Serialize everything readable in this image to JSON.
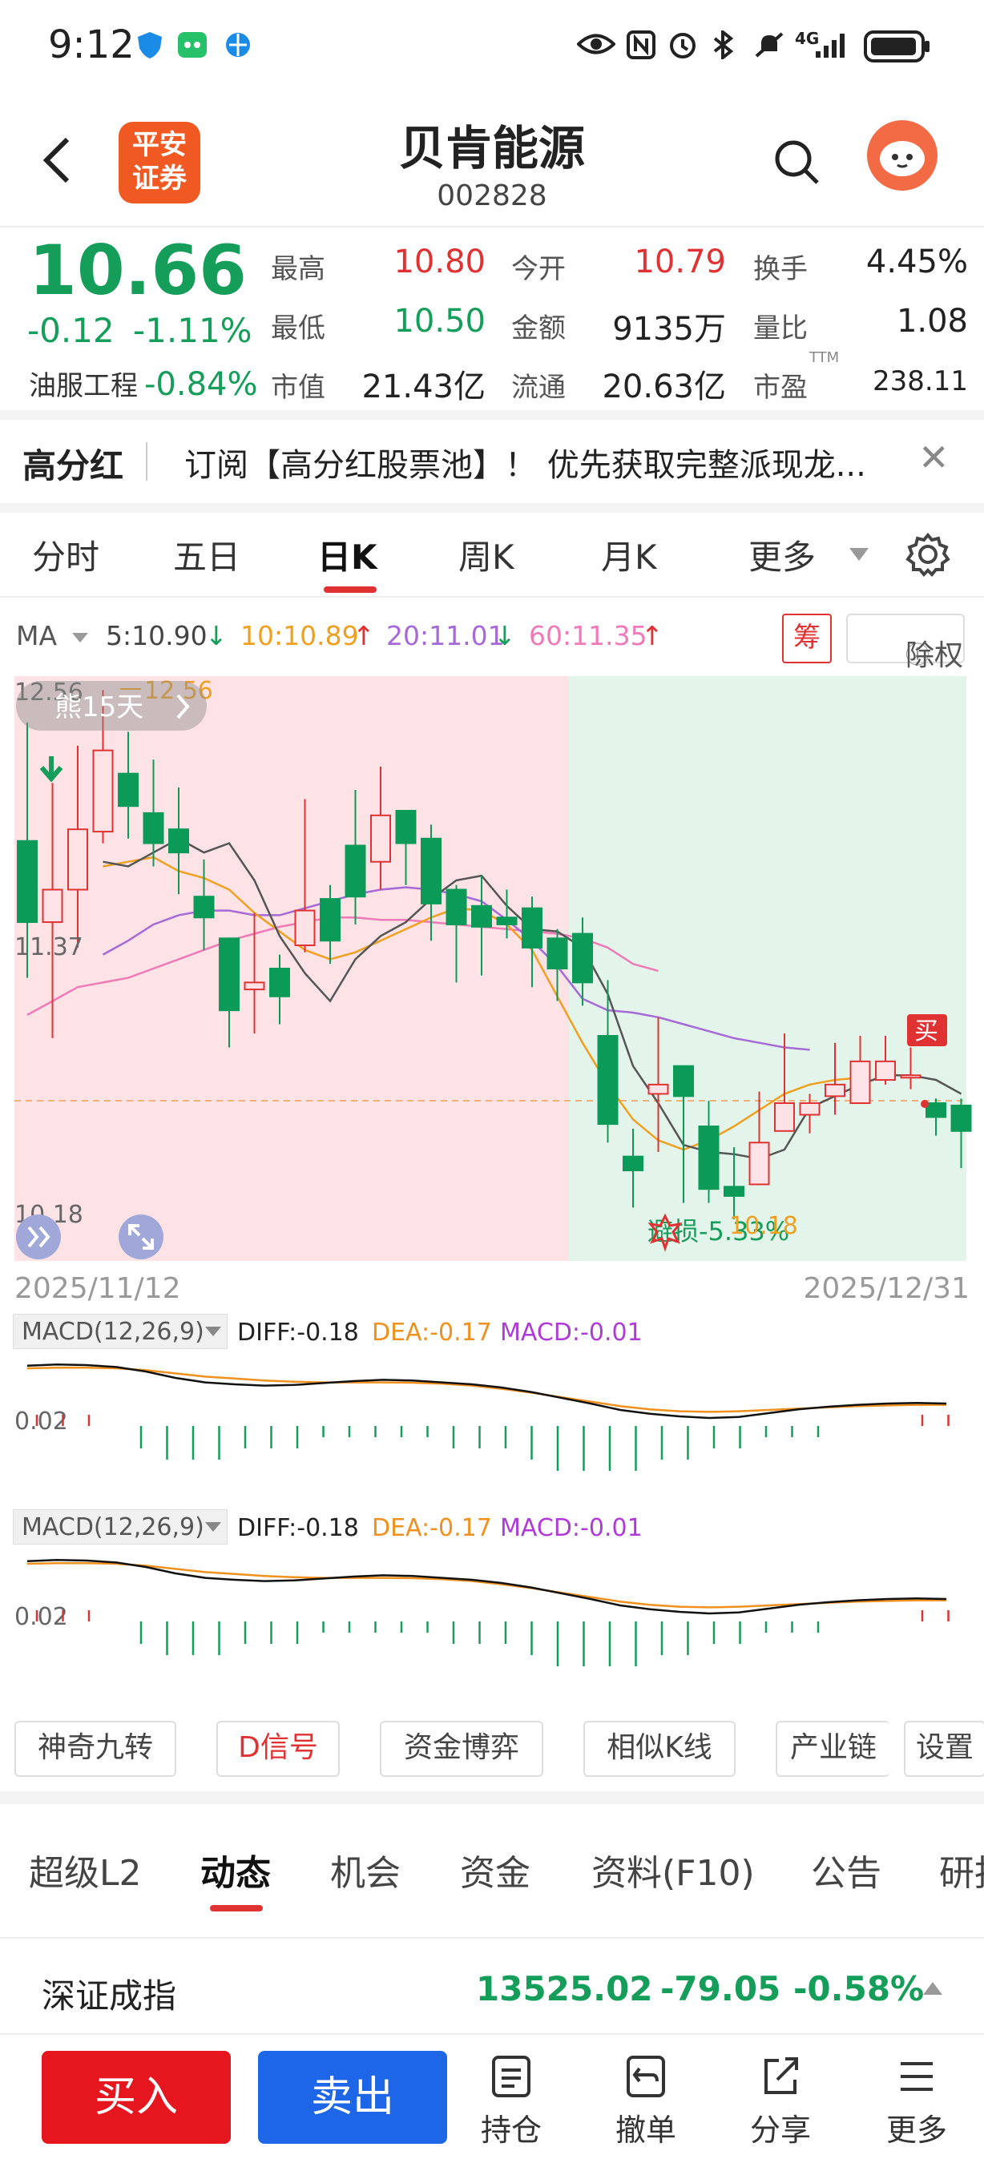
{
  "status_bar": {
    "time": "9:12",
    "net": "4G"
  },
  "header": {
    "stock_name": "贝肯能源",
    "stock_code": "002828",
    "broker_logo_line1": "平安",
    "broker_logo_line2": "证券"
  },
  "quote": {
    "price": "10.66",
    "change": "-0.12",
    "change_pct": "-1.11%",
    "sector_name": "油服工程",
    "sector_pct": "-0.84%",
    "fields": [
      {
        "label": "最高",
        "value": "10.80",
        "color": "#e03232"
      },
      {
        "label": "今开",
        "value": "10.79",
        "color": "#e03232"
      },
      {
        "label": "换手",
        "value": "4.45%",
        "color": "#222222"
      },
      {
        "label": "最低",
        "value": "10.50",
        "color": "#159d5a"
      },
      {
        "label": "金额",
        "value": "9135万",
        "color": "#222222"
      },
      {
        "label": "量比",
        "value": "1.08",
        "color": "#222222"
      },
      {
        "label": "市值",
        "value": "21.43亿",
        "color": "#222222"
      },
      {
        "label": "流通",
        "value": "20.63亿",
        "color": "#222222"
      },
      {
        "label": "市盈",
        "value": "238.11",
        "color": "#222222",
        "sup": "TTM"
      }
    ]
  },
  "banner": {
    "tag": "高分红",
    "text": "订阅【高分红股票池】！ 优先获取完整派现龙...",
    "close": "✕"
  },
  "period_tabs": [
    {
      "label": "分时"
    },
    {
      "label": "五日"
    },
    {
      "label": "日K",
      "active": true
    },
    {
      "label": "周K"
    },
    {
      "label": "月K"
    },
    {
      "label": "更多"
    }
  ],
  "ma": {
    "label": "MA",
    "ma5": "5:10.90",
    "ma10": "10:10.89",
    "ma20": "20:11.01",
    "ma60": "60:11.35",
    "chou": "筹",
    "chuquan": "除权"
  },
  "kline": {
    "price_high": "12.56",
    "price_mid": "11.37",
    "price_low": "10.18",
    "high_mark": "12.56",
    "bear_badge": "熊15天",
    "low_mark": "10.18",
    "stop_loss": "避损-5.33%",
    "buy_tag": "买",
    "date_start": "2025/11/12",
    "date_end": "2025/12/31"
  },
  "macd_panels": [
    {
      "name": "MACD(12,26,9)",
      "diff": "DIFF:-0.18",
      "dea": "DEA:-0.17",
      "macd": "MACD:-0.01",
      "axis": "0.02"
    },
    {
      "name": "MACD(12,26,9)",
      "diff": "DIFF:-0.18",
      "dea": "DEA:-0.17",
      "macd": "MACD:-0.01",
      "axis": "0.02"
    }
  ],
  "tools": [
    "神奇九转",
    "D信号",
    "资金博弈",
    "相似K线",
    "产业链",
    "设置"
  ],
  "bottom_tabs": [
    {
      "label": "超级L2"
    },
    {
      "label": "动态",
      "active": true
    },
    {
      "label": "机会"
    },
    {
      "label": "资金"
    },
    {
      "label": "资料(F10)"
    },
    {
      "label": "公告"
    },
    {
      "label": "研报"
    }
  ],
  "index_bar": {
    "name": "深证成指",
    "value": "13525.02",
    "change": "-79.05",
    "pct": "-0.58%"
  },
  "actions": {
    "buy": "买入",
    "sell": "卖出",
    "items": [
      "持仓",
      "撤单",
      "分享",
      "更多"
    ]
  },
  "chart_data": {
    "type": "candlestick",
    "price_axis_labels": [
      12.56,
      11.37,
      10.18
    ],
    "date_range": [
      "2025/11/12",
      "2025/12/31"
    ],
    "candles": [
      [
        11.91,
        11.56,
        12.42,
        11.32
      ],
      [
        11.56,
        11.7,
        12.16,
        11.06
      ],
      [
        11.7,
        11.96,
        12.32,
        11.45
      ],
      [
        11.95,
        12.3,
        12.56,
        11.9
      ],
      [
        12.2,
        12.06,
        12.38,
        11.92
      ],
      [
        12.03,
        11.9,
        12.26,
        11.8
      ],
      [
        11.96,
        11.86,
        12.14,
        11.68
      ],
      [
        11.67,
        11.58,
        11.83,
        11.44
      ],
      [
        11.49,
        11.18,
        11.48,
        11.02
      ],
      [
        11.27,
        11.3,
        11.6,
        11.08
      ],
      [
        11.36,
        11.24,
        11.42,
        11.12
      ],
      [
        11.46,
        11.61,
        12.09,
        11.43
      ],
      [
        11.66,
        11.48,
        11.72,
        11.38
      ],
      [
        11.89,
        11.67,
        12.13,
        11.55
      ],
      [
        11.82,
        12.02,
        12.23,
        11.7
      ],
      [
        12.04,
        11.9,
        12.03,
        11.72
      ],
      [
        11.92,
        11.64,
        11.98,
        11.48
      ],
      [
        11.7,
        11.55,
        11.72,
        11.3
      ],
      [
        11.63,
        11.54,
        11.76,
        11.33
      ],
      [
        11.58,
        11.55,
        11.7,
        11.49
      ],
      [
        11.62,
        11.45,
        11.67,
        11.28
      ],
      [
        11.49,
        11.36,
        11.53,
        11.22
      ],
      [
        11.51,
        11.3,
        11.58,
        11.2
      ],
      [
        11.07,
        10.69,
        11.31,
        10.61
      ],
      [
        10.55,
        10.49,
        10.67,
        10.33
      ],
      [
        10.82,
        10.86,
        11.15,
        10.57
      ],
      [
        10.94,
        10.81,
        10.89,
        10.35
      ],
      [
        10.68,
        10.41,
        10.79,
        10.35
      ],
      [
        10.42,
        10.38,
        10.59,
        10.28
      ],
      [
        10.43,
        10.61,
        10.83,
        10.47
      ],
      [
        10.66,
        10.78,
        11.08,
        10.73
      ],
      [
        10.73,
        10.78,
        10.82,
        10.65
      ],
      [
        10.81,
        10.86,
        11.04,
        10.73
      ],
      [
        10.78,
        10.96,
        11.07,
        10.8
      ],
      [
        10.88,
        10.96,
        11.07,
        10.86
      ],
      [
        10.89,
        10.9,
        11.02,
        10.84
      ],
      [
        10.78,
        10.72,
        10.8,
        10.64
      ],
      [
        10.77,
        10.66,
        10.8,
        10.5
      ]
    ],
    "ma5": [
      11.82,
      11.8,
      11.86,
      11.92,
      11.86,
      11.9,
      11.74,
      11.5,
      11.34,
      11.22,
      11.4,
      11.5,
      11.56,
      11.66,
      11.74,
      11.76,
      11.63,
      11.53,
      11.52,
      11.45,
      11.25,
      10.94,
      10.78,
      10.6,
      10.57,
      10.56,
      10.54,
      10.58,
      10.76,
      10.81,
      10.86,
      10.9,
      10.9,
      10.88,
      10.82
    ],
    "ma10": [
      11.8,
      11.82,
      11.84,
      11.78,
      11.75,
      11.7,
      11.6,
      11.52,
      11.44,
      11.4,
      11.43,
      11.48,
      11.53,
      11.58,
      11.62,
      11.61,
      11.55,
      11.44,
      11.24,
      11.04,
      10.86,
      10.71,
      10.62,
      10.58,
      10.62,
      10.68,
      10.75,
      10.82,
      10.86,
      10.88,
      10.89
    ],
    "ma20": [
      11.42,
      11.48,
      11.55,
      11.59,
      11.61,
      11.61,
      11.59,
      11.59,
      11.62,
      11.65,
      11.68,
      11.7,
      11.71,
      11.7,
      11.68,
      11.65,
      11.57,
      11.48,
      11.37,
      11.23,
      11.18,
      11.17,
      11.15,
      11.12,
      11.09,
      11.06,
      11.04,
      11.02,
      11.01
    ],
    "ma60": [
      11.16,
      11.22,
      11.28,
      11.3,
      11.32,
      11.36,
      11.4,
      11.44,
      11.48,
      11.51,
      11.54,
      11.56,
      11.58,
      11.58,
      11.57,
      11.57,
      11.56,
      11.55,
      11.54,
      11.53,
      11.52,
      11.51,
      11.49,
      11.45,
      11.38,
      11.35
    ],
    "macd_hist": [
      0.01,
      0.01,
      0.01,
      0.0,
      -0.02,
      -0.03,
      -0.03,
      -0.03,
      -0.02,
      -0.02,
      -0.02,
      -0.01,
      -0.01,
      -0.01,
      -0.01,
      -0.01,
      -0.02,
      -0.02,
      -0.02,
      -0.03,
      -0.04,
      -0.04,
      -0.04,
      -0.04,
      -0.03,
      -0.03,
      -0.02,
      -0.02,
      -0.01,
      -0.01,
      -0.01,
      0.0,
      0.0,
      0.0,
      0.01,
      0.01
    ]
  }
}
